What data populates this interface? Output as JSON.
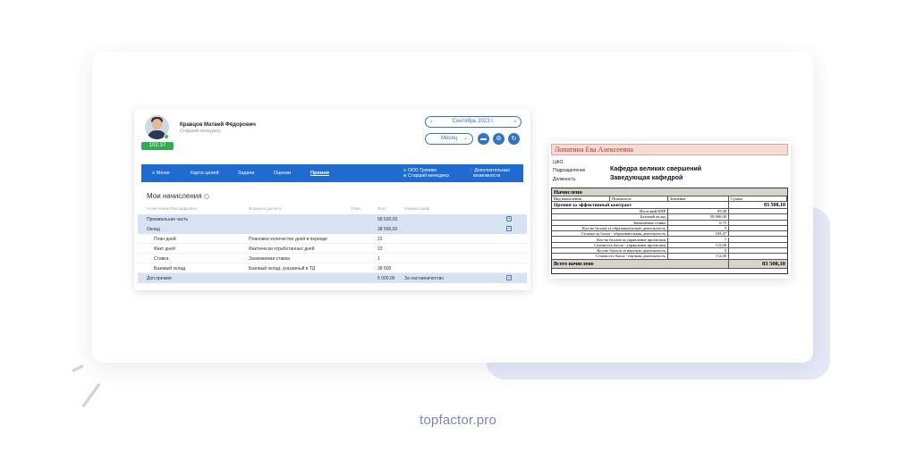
{
  "brand": "topfactor.pro",
  "app": {
    "user": {
      "name": "Кравцов Матвей Фёдорович",
      "role": "Старший менеджер",
      "score": "102.37"
    },
    "period": {
      "label": "Сентябрь 2023 г.",
      "prev": "‹",
      "next": "›"
    },
    "view_mode": "Месяц",
    "nav": {
      "items": [
        "Меню",
        "Карта целей",
        "Задачи",
        "Оценки",
        "Премия"
      ],
      "org_line1": "ООО Тропики",
      "org_line2": "Старший менеджер",
      "more_line1": "Дополнительные",
      "more_line2": "возможности"
    },
    "content": {
      "title": "Мои начисления",
      "columns": [
        "Начисление/Расшифровка",
        "Формула расчета",
        "План",
        "Факт",
        "Комментарий"
      ],
      "rows": [
        {
          "name": "Премиальная часть",
          "formula": "",
          "plan": "",
          "fact": "58 630,00",
          "comment": "",
          "type": "hl"
        },
        {
          "name": "Оклад",
          "formula": "",
          "plan": "",
          "fact": "38 500,00",
          "comment": "",
          "type": "hl"
        },
        {
          "name": "План дней",
          "formula": "Плановое количество дней в периоде",
          "plan": "",
          "fact": "22",
          "comment": "",
          "type": "sub"
        },
        {
          "name": "Факт дней",
          "formula": "Фактически отработанных дней",
          "plan": "",
          "fact": "22",
          "comment": "",
          "type": "sub"
        },
        {
          "name": "Ставка",
          "formula": "Занимаемая ставка",
          "plan": "",
          "fact": "1",
          "comment": "",
          "type": "sub"
        },
        {
          "name": "Базовый оклад",
          "formula": "Базовый оклад, указанный в ТД",
          "plan": "",
          "fact": "38 500",
          "comment": "",
          "type": "sub"
        },
        {
          "name": "Доп.премия",
          "formula": "",
          "plan": "",
          "fact": "5 000,00",
          "comment": "За наставничество",
          "type": "hl"
        }
      ]
    }
  },
  "report": {
    "name": "Лопатина Ева Алексеевна",
    "cfo_label": "ЦФО",
    "dept_label": "Подразделение",
    "dept_value": "Кафедра великих свершений",
    "position_label": "Должность",
    "position_value": "Заведующая кафедрой",
    "section": "Начислено",
    "columns": [
      "Вид начисления",
      "Показатель",
      "Значение",
      "Сумма"
    ],
    "group": {
      "name": "Премия за эффективный контракт",
      "sum": "83 508,10"
    },
    "items": [
      {
        "label": "Итоговый КПР",
        "value": "95,00"
      },
      {
        "label": "Базовый оклад",
        "value": "58 000,00"
      },
      {
        "label": "Занимаемая ставка",
        "value": "0,75"
      },
      {
        "label": "Кол-во баллов за образовательную деятельность",
        "value": "5"
      },
      {
        "label": "Стоимость балла - образовательная деятельность",
        "value": "105,47"
      },
      {
        "label": "Кол-во баллов за управление проектами",
        "value": "7"
      },
      {
        "label": "Стоимость балла - управление проектами",
        "value": "115,00"
      },
      {
        "label": "Кол-во баллов за научную деятельность",
        "value": "5"
      },
      {
        "label": "Стоимость балла - научная деятельность",
        "value": "112,00"
      }
    ],
    "total": {
      "label": "Всего начислено",
      "sum": "83 508,10"
    }
  }
}
